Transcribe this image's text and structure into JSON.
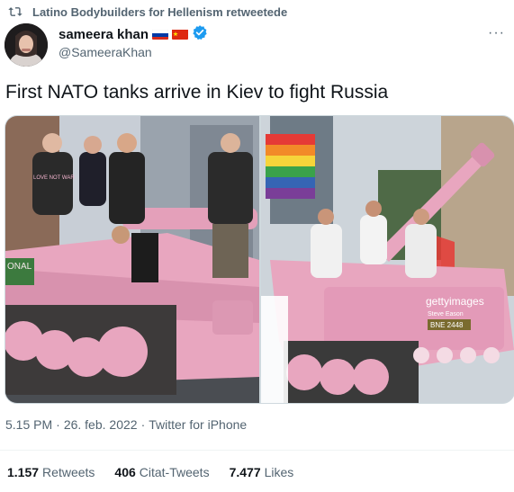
{
  "retweet": {
    "label": "Latino Bodybuilders for Hellenism retweetede",
    "icon": "retweet-icon"
  },
  "author": {
    "display_name": "sameera khan",
    "handle": "@SameeraKhan",
    "flags": [
      "russia-flag",
      "china-flag"
    ],
    "verified_icon": "verified-badge-icon"
  },
  "more_label": "···",
  "tweet": {
    "text": "First NATO tanks arrive in Kiev to fight Russia"
  },
  "media": {
    "left_photo": {
      "tank_side_text": "ONAL",
      "shirt_text": "LOVE NOT WAR"
    },
    "right_photo": {
      "watermark": "gettyimages",
      "credit": "Steve Eason",
      "plate": "BNE 2448"
    }
  },
  "meta": {
    "time": "5.15 PM",
    "dot": "·",
    "date": "26. feb. 2022",
    "source": "Twitter for iPhone"
  },
  "stats": [
    {
      "value": "1.157",
      "label": "Retweets"
    },
    {
      "value": "406",
      "label": "Citat-Tweets"
    },
    {
      "value": "7.477",
      "label": "Likes"
    }
  ],
  "colors": {
    "text": "#0f1419",
    "secondary": "#536471",
    "verified": "#1d9bf0",
    "tank_pink": "#e8a6bf"
  }
}
